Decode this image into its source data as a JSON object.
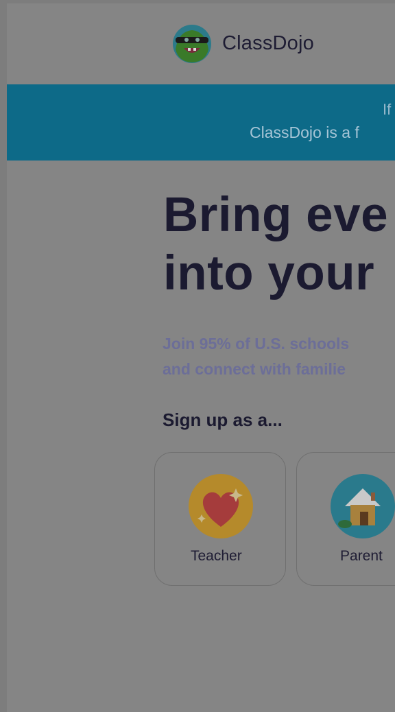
{
  "header": {
    "brand": "ClassDojo"
  },
  "banner": {
    "line1": "If",
    "line2": "ClassDojo is a f"
  },
  "hero": {
    "title_line1": "Bring eve",
    "title_line2": "into your",
    "subtitle_line1": "Join 95% of U.S. schools",
    "subtitle_line2": "and connect with familie"
  },
  "signup": {
    "label": "Sign up as a...",
    "options": [
      {
        "label": "Teacher",
        "icon": "heart-icon"
      },
      {
        "label": "Parent",
        "icon": "house-icon"
      }
    ]
  },
  "colors": {
    "banner": "#0d6a88",
    "overlay": "#858585",
    "heading": "#1b1a30",
    "subtitle": "#6c6e98"
  }
}
